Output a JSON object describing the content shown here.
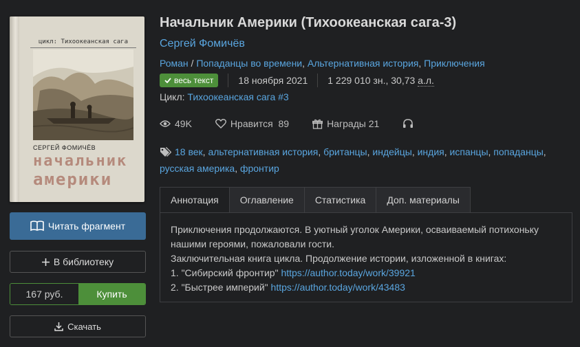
{
  "cover": {
    "cycle_text": "цикл: Тихоокеанская сага",
    "author_text": "СЕРГЕЙ ФОМИЧЁВ",
    "title_line1": "начальник",
    "title_line2": "америки"
  },
  "actions": {
    "read_label": "Читать фрагмент",
    "library_label": "В библиотеку",
    "price": "167 руб.",
    "buy_label": "Купить",
    "download_label": "Скачать"
  },
  "book": {
    "title": "Начальник Америки (Тихоокеанская сага-3)",
    "author": "Сергей Фомичёв",
    "genres": [
      "Роман",
      "Попаданцы во времени",
      "Альтернативная история",
      "Приключения"
    ],
    "badge": "весь текст",
    "date": "18 ноября 2021",
    "size": "1 229 010 зн., 30,73 ",
    "size_unit": "а.л.",
    "cycle_label": "Цикл:",
    "cycle_name": "Тихоокеанская сага #3"
  },
  "stats": {
    "views": "49K",
    "likes_label": "Нравится",
    "likes": "89",
    "awards_label": "Награды",
    "awards": "21"
  },
  "tags": [
    "18 век",
    "альтернативная история",
    "британцы",
    "индейцы",
    "индия",
    "испанцы",
    "попаданцы",
    "русская америка",
    "фронтир"
  ],
  "tabs": [
    "Аннотация",
    "Оглавление",
    "Статистика",
    "Доп. материалы"
  ],
  "annotation": {
    "line1": "Приключения продолжаются. В уютный уголок Америки, осваиваемый потихоньку нашими героями, пожаловали гости.",
    "line2": "Заключительная книга цикла. Продолжение истории, изложенной в книгах:",
    "item1_text": "1. \"Сибирский фронтир\" ",
    "item1_link": "https://author.today/work/39921",
    "item2_text": "2. \"Быстрее империй\" ",
    "item2_link": "https://author.today/work/43483"
  },
  "colors": {
    "background": "#1f2022",
    "link": "#5aa6e0",
    "read_button": "#3a6b96",
    "buy_green": "#4d8f3a"
  }
}
